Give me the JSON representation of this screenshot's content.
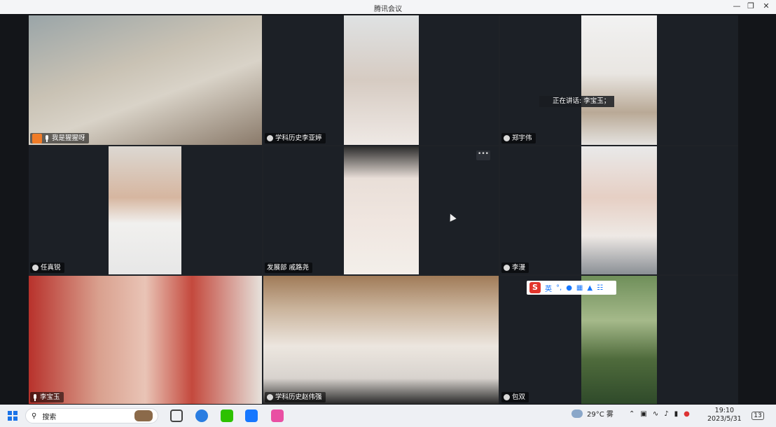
{
  "window": {
    "title": "腾讯会议",
    "controls": [
      "minimize-icon",
      "restore-icon",
      "close-icon"
    ]
  },
  "participants": [
    {
      "name": "我是猩猩呀",
      "mic": true,
      "host_badge": true
    },
    {
      "name": "学科历史李亚婷",
      "mic": false
    },
    {
      "name": "郑宇伟",
      "mic": false
    },
    {
      "name": "任真锐",
      "mic": false
    },
    {
      "name": "发展部 戚路尧",
      "mic": false
    },
    {
      "name": "李漫",
      "mic": false
    },
    {
      "name": "李宝玉",
      "mic": true
    },
    {
      "name": "学科历史赵伟强",
      "mic": false
    },
    {
      "name": "包双",
      "mic": false
    }
  ],
  "speaking_indicator": {
    "text": "正在讲话: 李宝玉；"
  },
  "more_button": {
    "label": "•••"
  },
  "ime": {
    "logo": "S",
    "mode": "英"
  },
  "taskbar": {
    "search_placeholder": "搜索",
    "weather": "29°C 雾",
    "clock_time": "19:10",
    "clock_date": "2023/5/31",
    "notification_count": "13"
  },
  "colors": {
    "accent": "#1677ff",
    "host_badge": "#f07c28",
    "ime_red": "#e2362c"
  }
}
